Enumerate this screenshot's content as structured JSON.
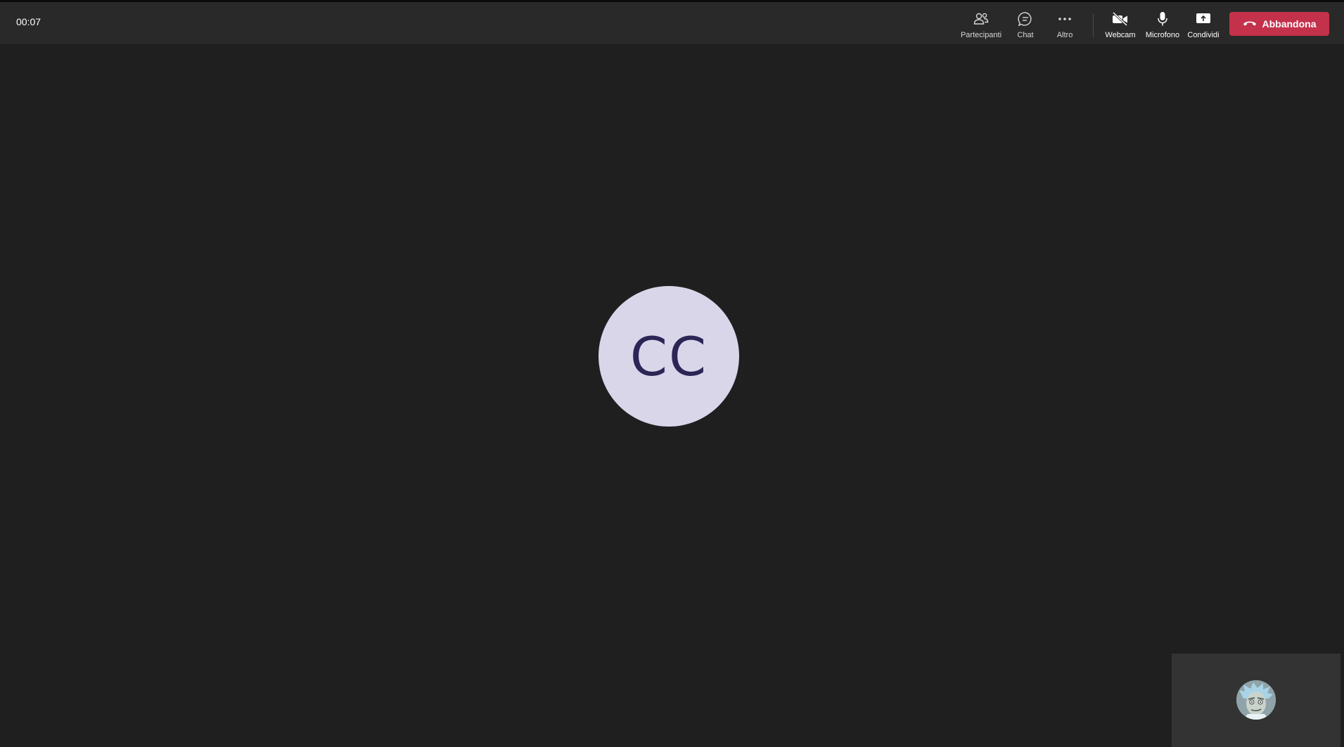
{
  "meeting": {
    "timer": "00:07"
  },
  "toolbar": {
    "participants_label": "Partecipanti",
    "chat_label": "Chat",
    "more_label": "Altro",
    "webcam_label": "Webcam",
    "mic_label": "Microfono",
    "share_label": "Condividi",
    "leave_label": "Abbandona"
  },
  "stage": {
    "participant_initials": "CC"
  },
  "icons": {
    "participants": "people-icon",
    "chat": "chat-icon",
    "more": "ellipsis-icon",
    "webcam": "camera-off-icon",
    "mic": "microphone-icon",
    "share": "share-screen-icon",
    "leave": "phone-hangup-icon"
  },
  "colors": {
    "background": "#1f1f1f",
    "topbar": "#292929",
    "leave": "#c4314b",
    "avatar_bg": "#d9d6ea",
    "avatar_text": "#2b2655"
  }
}
